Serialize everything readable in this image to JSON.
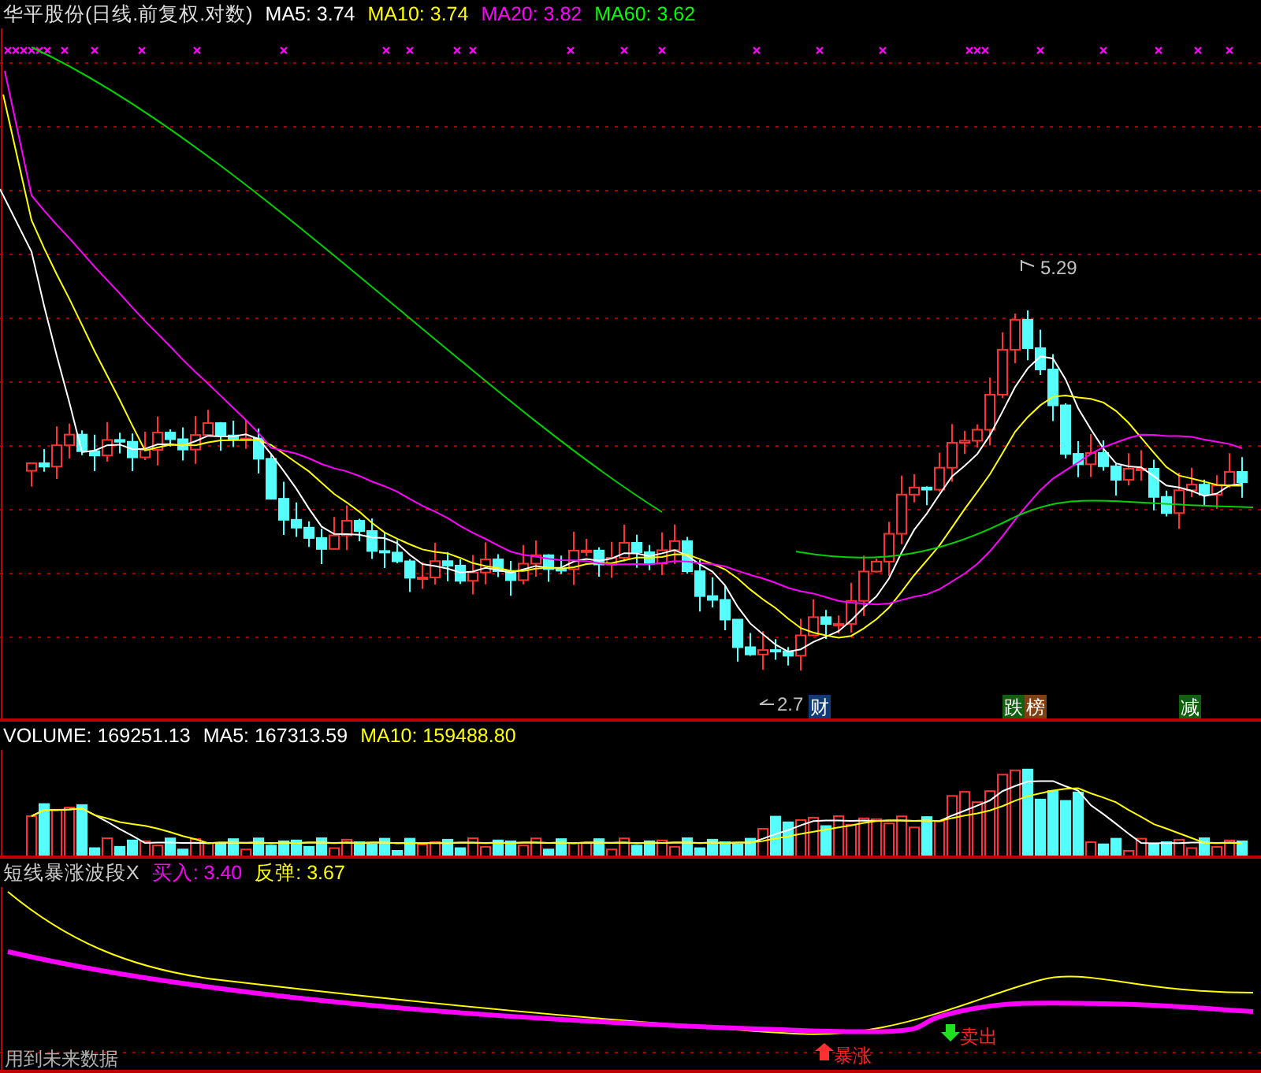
{
  "price_panel": {
    "title": "华平股份(日线.前复权.对数)",
    "indicators": [
      {
        "label": "MA5: 3.74",
        "color": "#ffffff"
      },
      {
        "label": "MA10: 3.74",
        "color": "#ffff00"
      },
      {
        "label": "MA20: 3.82",
        "color": "#ff00ff"
      },
      {
        "label": "MA60: 3.62",
        "color": "#00ff00"
      }
    ],
    "annotations": [
      {
        "kind": "high",
        "text": "5.29"
      },
      {
        "kind": "low",
        "text": "2.7"
      }
    ],
    "tags": [
      {
        "text": "财",
        "color": "#103a78"
      },
      {
        "text": "跌",
        "color": "#106010"
      },
      {
        "text": "榜",
        "color": "#804010"
      },
      {
        "text": "减",
        "color": "#106010"
      }
    ]
  },
  "volume_panel": {
    "indicators": [
      {
        "label": "VOLUME: 169251.13",
        "color": "#ffffff"
      },
      {
        "label": "MA5: 167313.59",
        "color": "#ffffff"
      },
      {
        "label": "MA10: 159488.80",
        "color": "#ffff00"
      }
    ]
  },
  "signal_panel": {
    "title": "短线暴涨波段X",
    "indicators": [
      {
        "label": "买入: 3.40",
        "color": "#ff00ff"
      },
      {
        "label": "反弹: 3.67",
        "color": "#ffff00"
      }
    ],
    "signals": [
      {
        "kind": "buy",
        "text": "暴涨"
      },
      {
        "kind": "sell",
        "text": "卖出"
      }
    ],
    "footnote": "用到未来数据"
  }
}
